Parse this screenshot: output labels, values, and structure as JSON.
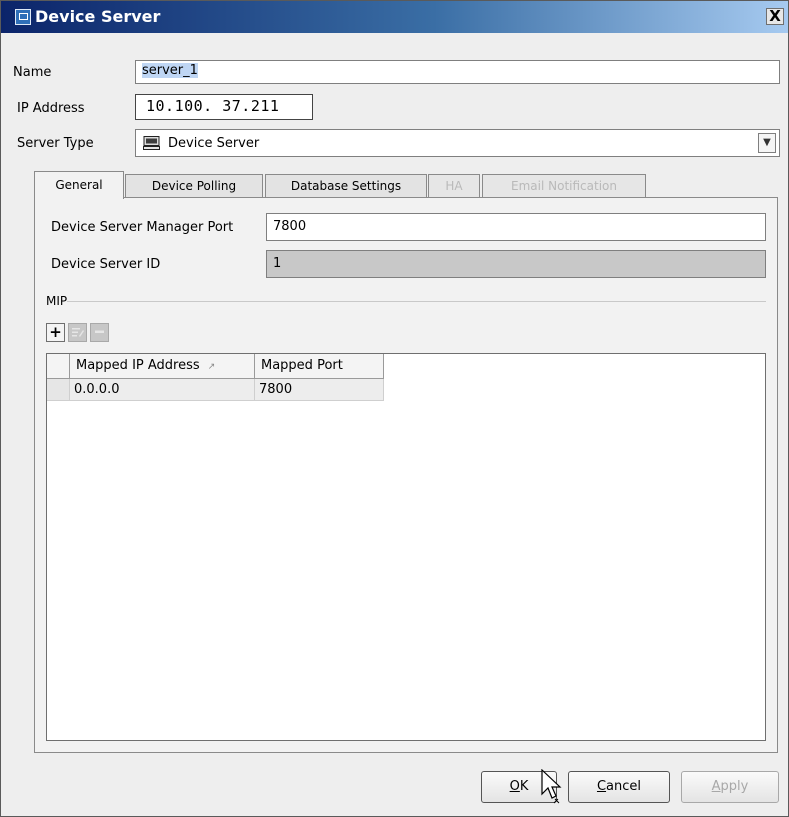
{
  "window": {
    "title": "Device Server",
    "close_glyph": "X"
  },
  "form": {
    "name_label": "Name",
    "name_value": "server_1",
    "ip_label": "IP Address",
    "ip_value": "10.100. 37.211",
    "type_label": "Server Type",
    "type_value": "Device Server",
    "type_icon": "computer-icon"
  },
  "tabs": [
    {
      "label": "General",
      "state": "active"
    },
    {
      "label": "Device Polling",
      "state": "normal"
    },
    {
      "label": "Database Settings",
      "state": "normal"
    },
    {
      "label": "HA",
      "state": "disabled"
    },
    {
      "label": "Email Notification",
      "state": "disabled"
    }
  ],
  "general": {
    "manager_port_label": "Device Server Manager Port",
    "manager_port_value": "7800",
    "server_id_label": "Device Server ID",
    "server_id_value": "1",
    "mip_section": "MIP",
    "toolbar": {
      "add": "+",
      "edit_icon": "edit-icon",
      "remove_icon": "minus-icon"
    },
    "table": {
      "columns": [
        "Mapped IP Address",
        "Mapped Port"
      ],
      "sort_indicator": "↗",
      "rows": [
        [
          "0.0.0.0",
          "7800"
        ]
      ]
    }
  },
  "buttons": {
    "ok_mnemonic": "O",
    "ok_rest": "K",
    "cancel_mnemonic": "C",
    "cancel_rest": "ancel",
    "apply_mnemonic": "A",
    "apply_rest": "pply"
  }
}
